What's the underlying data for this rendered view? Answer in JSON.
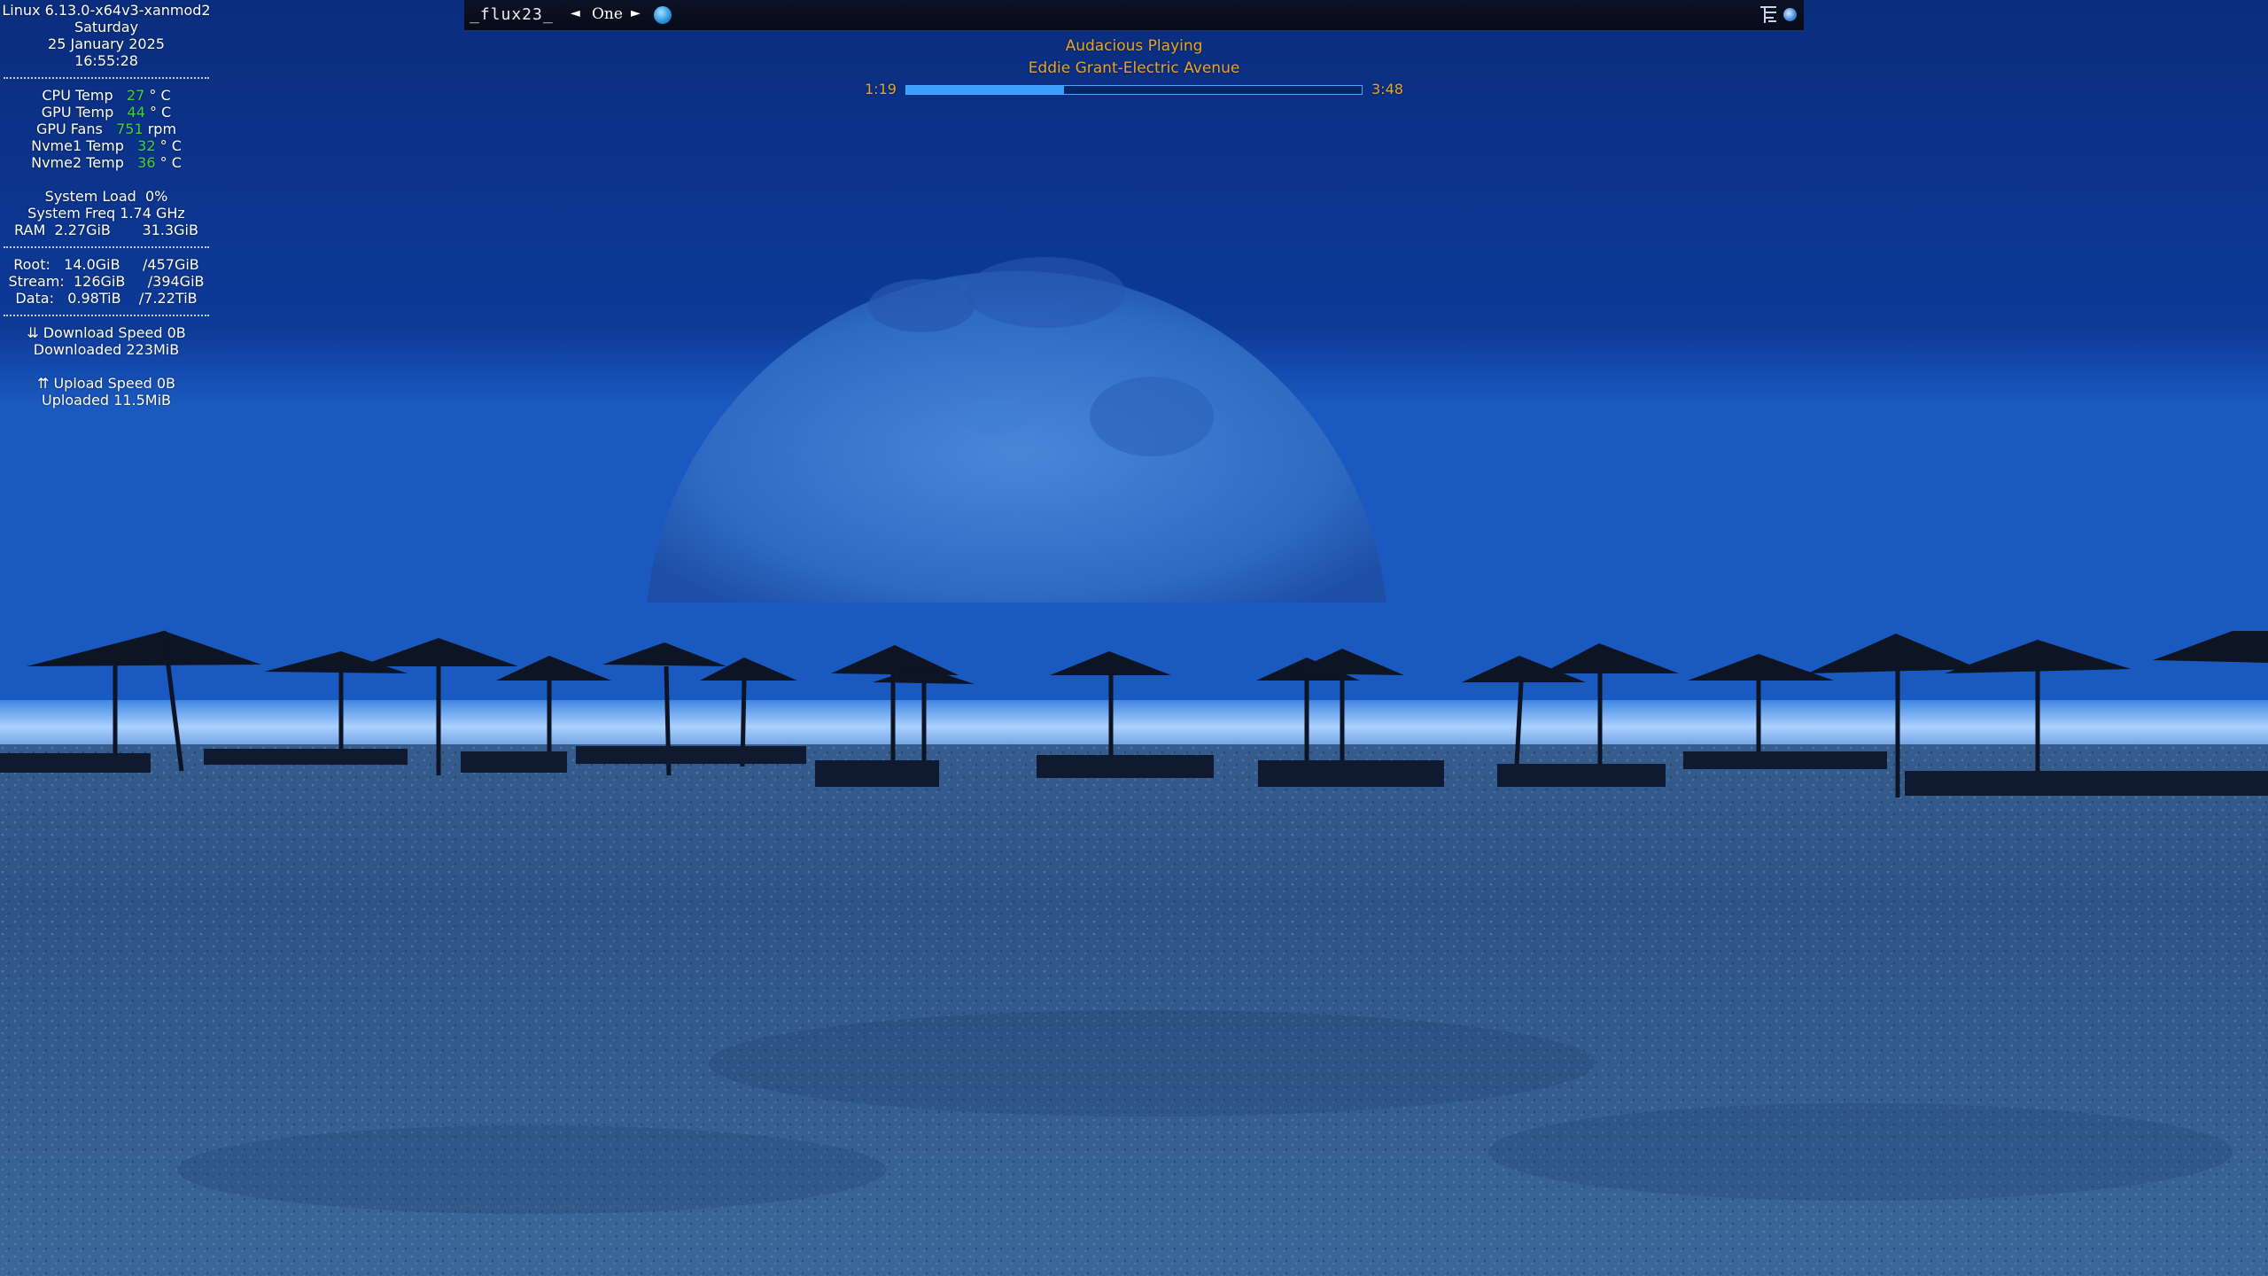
{
  "conky": {
    "kernel": "Linux 6.13.0-x64v3-xanmod2",
    "weekday": "Saturday",
    "date": "25 January 2025",
    "time": "16:55:28",
    "temps": [
      {
        "label": "CPU Temp",
        "value": "27",
        "unit": "° C"
      },
      {
        "label": "GPU Temp",
        "value": "44",
        "unit": "° C"
      },
      {
        "label": "GPU Fans",
        "value": "751",
        "unit": "rpm"
      },
      {
        "label": "Nvme1 Temp",
        "value": "32",
        "unit": "° C"
      },
      {
        "label": "Nvme2 Temp",
        "value": "36",
        "unit": "° C"
      }
    ],
    "system_load": "System Load  0%",
    "system_freq": "System Freq 1.74 GHz",
    "ram": "RAM  2.27GiB       31.3GiB",
    "disks": [
      "Root:   14.0GiB     /457GiB",
      "Stream:  126GiB     /394GiB",
      "Data:   0.98TiB    /7.22TiB"
    ],
    "download_speed": "⇊ Download Speed 0B",
    "downloaded": "Downloaded 223MiB",
    "upload_speed": "⇈ Upload Speed 0B",
    "uploaded": "Uploaded 11.5MiB",
    "value_color": "#3fd43f"
  },
  "panel": {
    "workspace_name": "_flux23_",
    "prev_label": "◄",
    "workspace_label": "One",
    "next_label": "►",
    "app_icon": "browser-icon",
    "tray_icons": [
      "menu-tree-icon",
      "network-icon"
    ]
  },
  "player": {
    "status": "Audacious  Playing",
    "track": "Eddie Grant-Electric Avenue",
    "elapsed": "1:19",
    "total": "3:48",
    "progress_fraction": 0.346,
    "text_color": "#e8a42a",
    "bar_color": "#3a9dff"
  }
}
